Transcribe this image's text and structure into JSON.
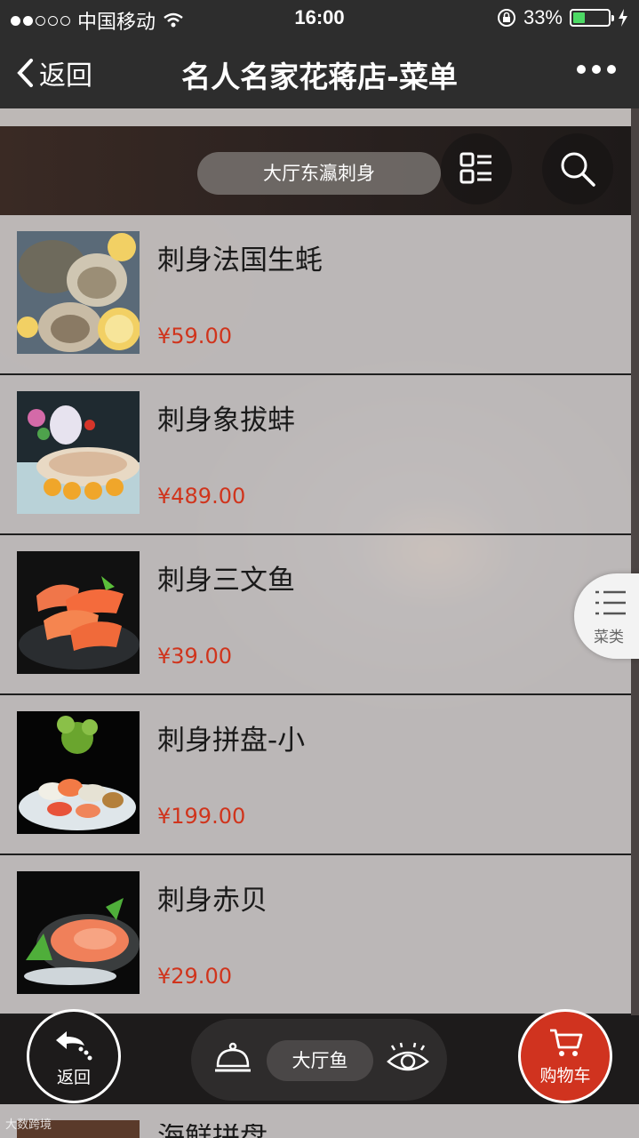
{
  "status_bar": {
    "carrier": "中国移动",
    "time": "16:00",
    "battery": "33%",
    "battery_level": 0.33
  },
  "nav": {
    "back_label": "返回",
    "title": "名人名家花蒋店-菜单"
  },
  "filter": {
    "category": "大厅东瀛刺身"
  },
  "menu": {
    "items": [
      {
        "name": "刺身法国生蚝",
        "price": "¥59.00"
      },
      {
        "name": "刺身象拔蚌",
        "price": "¥489.00"
      },
      {
        "name": "刺身三文鱼",
        "price": "¥39.00"
      },
      {
        "name": "刺身拼盘-小",
        "price": "¥199.00"
      },
      {
        "name": "刺身赤贝",
        "price": "¥29.00"
      }
    ],
    "peek_name": "海鲜拼盘"
  },
  "side_tab": {
    "label": "菜类"
  },
  "bottom": {
    "back_label": "返回",
    "center_label": "大厅鱼",
    "cart_label": "购物车"
  },
  "watermark": "大数跨境",
  "colors": {
    "price": "#d0341c",
    "cart": "#d0331f",
    "bar": "#2d2d2d"
  }
}
